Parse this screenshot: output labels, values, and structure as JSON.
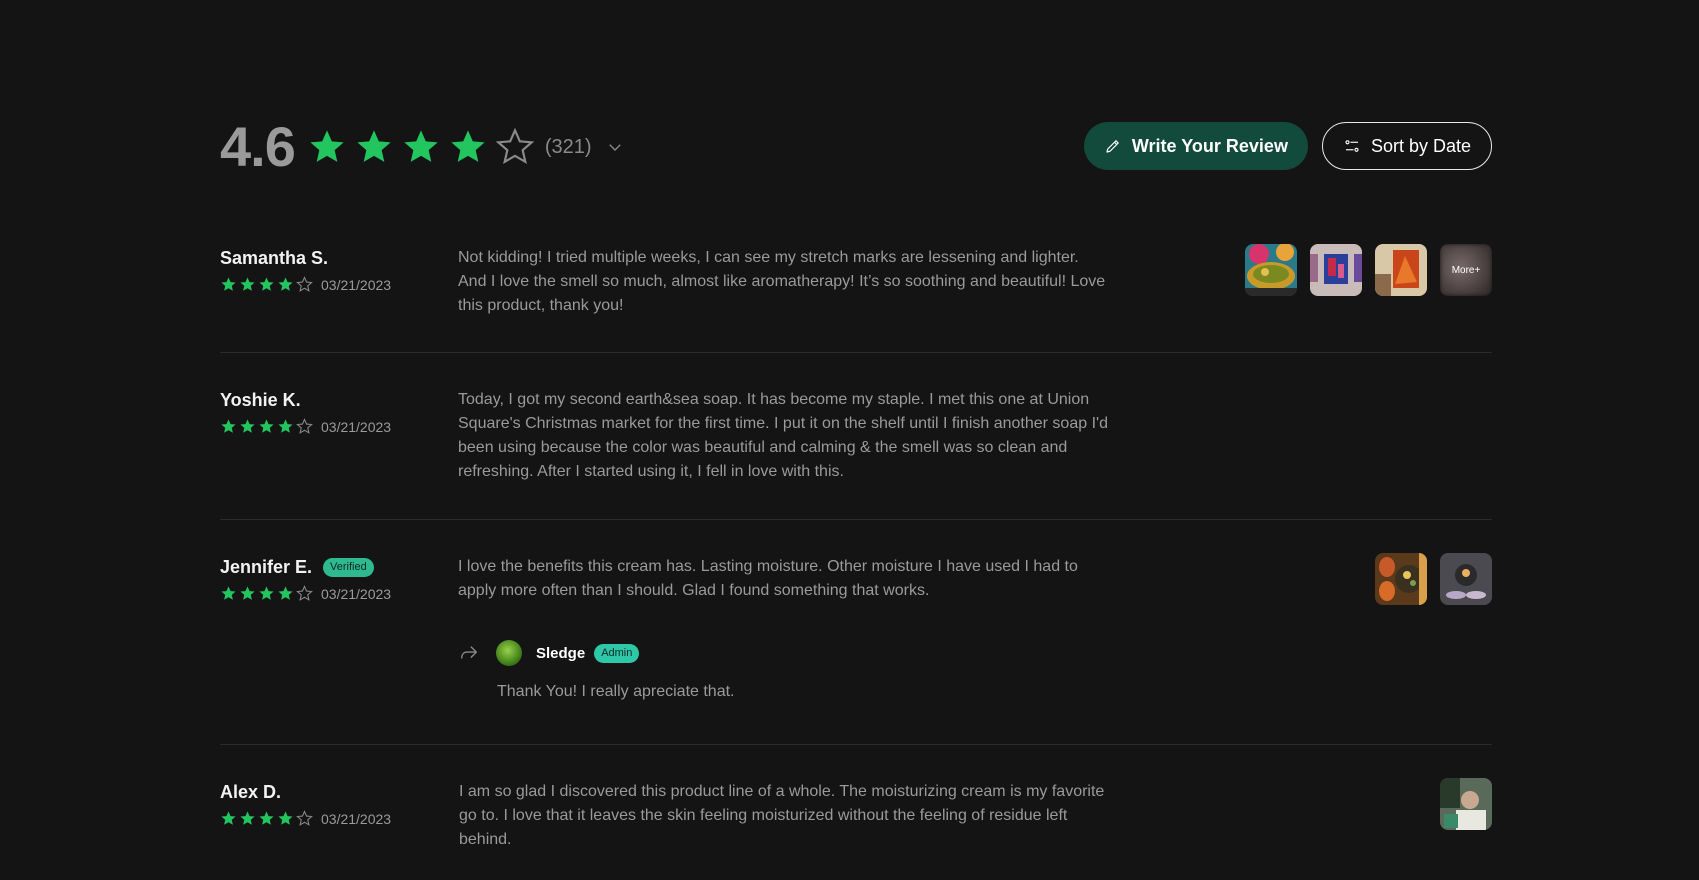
{
  "summary": {
    "average": "4.6",
    "stars_filled": 4,
    "stars_total": 5,
    "count": "(321)",
    "star_color": "#22c55e"
  },
  "actions": {
    "write_review": "Write Your Review",
    "sort_by": "Sort by Date"
  },
  "reviews": [
    {
      "name": "Samantha S.",
      "rating": 4,
      "date": "03/21/2023",
      "text": "Not kidding! I tried multiple weeks, I can see my stretch marks are lessening and lighter. And I love the smell so much, almost like aromatherapy! It’s so soothing and beautiful! Love this product, thank you!",
      "more_label": "More+"
    },
    {
      "name": "Yoshie K.",
      "rating": 4,
      "date": "03/21/2023",
      "text": "Today, I got my second earth&sea soap. It has become my staple. I met this one at Union Square's Christmas market for the first time. I put it on the shelf until I finish another soap I'd been using because the color was beautiful and calming & the smell was so clean and refreshing. After I started using it, I fell in love with this."
    },
    {
      "name": "Jennifer E.",
      "badge": "Verified",
      "rating": 4,
      "date": "03/21/2023",
      "text": "I love the benefits this cream has. Lasting moisture. Other moisture I have used I had to apply more often than I should. Glad I found something that works.",
      "reply": {
        "name": "Sledge",
        "badge": "Admin",
        "text": "Thank You! I really apreciate that."
      }
    },
    {
      "name": "Alex D.",
      "rating": 4,
      "date": "03/21/2023",
      "text": "I am so glad I discovered this product line of a whole. The moisturizing cream is my favorite go to. I love that it leaves the skin feeling moisturized without the feeling of residue left behind."
    }
  ]
}
